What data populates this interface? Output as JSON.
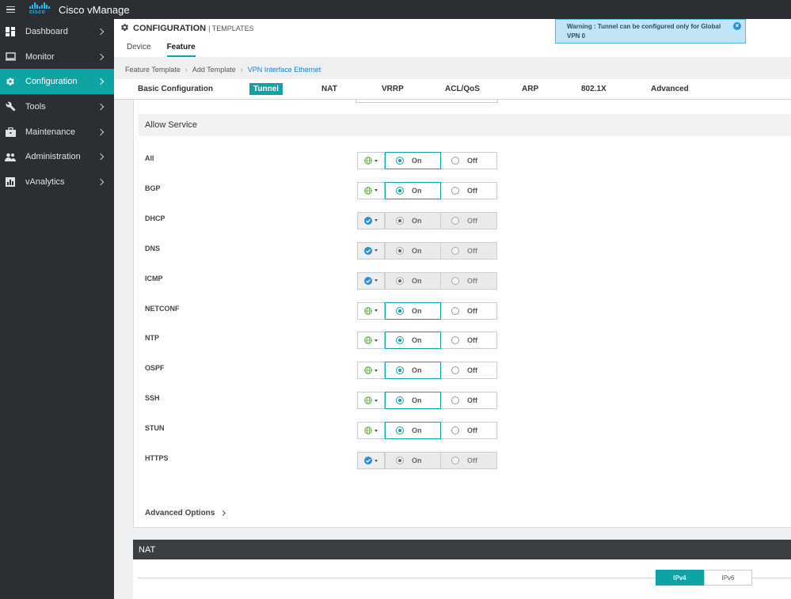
{
  "app": {
    "title": "Cisco vManage",
    "logo_text": "cisco"
  },
  "sidebar": {
    "items": [
      {
        "label": "Dashboard",
        "icon": "dashboard-icon"
      },
      {
        "label": "Monitor",
        "icon": "monitor-icon"
      },
      {
        "label": "Configuration",
        "icon": "gear-icon",
        "active": true
      },
      {
        "label": "Tools",
        "icon": "wrench-icon"
      },
      {
        "label": "Maintenance",
        "icon": "toolbox-icon"
      },
      {
        "label": "Administration",
        "icon": "users-icon"
      },
      {
        "label": "vAnalytics",
        "icon": "analytics-icon"
      }
    ]
  },
  "header": {
    "title": "CONFIGURATION",
    "subtitle": "| TEMPLATES",
    "tabs": [
      "Device",
      "Feature"
    ],
    "active_tab": "Feature"
  },
  "warning": {
    "text": "Warning : Tunnel can be configured only for Global VPN 0"
  },
  "breadcrumb": [
    "Feature Template",
    "Add Template",
    "VPN Interface Ethernet"
  ],
  "section_tabs": [
    "Basic Configuration",
    "Tunnel",
    "NAT",
    "VRRP",
    "ACL/QoS",
    "ARP",
    "802.1X",
    "Advanced"
  ],
  "active_section": "Tunnel",
  "allow_service": {
    "title": "Allow Service",
    "on_label": "On",
    "off_label": "Off",
    "services": [
      {
        "name": "All",
        "scope": "global",
        "value": "On"
      },
      {
        "name": "BGP",
        "scope": "global",
        "value": "On"
      },
      {
        "name": "DHCP",
        "scope": "default",
        "value": "On"
      },
      {
        "name": "DNS",
        "scope": "default",
        "value": "On"
      },
      {
        "name": "ICMP",
        "scope": "default",
        "value": "On"
      },
      {
        "name": "NETCONF",
        "scope": "global",
        "value": "On"
      },
      {
        "name": "NTP",
        "scope": "global",
        "value": "On"
      },
      {
        "name": "OSPF",
        "scope": "global",
        "value": "On"
      },
      {
        "name": "SSH",
        "scope": "global",
        "value": "On"
      },
      {
        "name": "STUN",
        "scope": "global",
        "value": "On"
      },
      {
        "name": "HTTPS",
        "scope": "default",
        "value": "On"
      }
    ],
    "advanced_options": "Advanced Options"
  },
  "nat": {
    "title": "NAT",
    "ip_tabs": [
      "IPv4",
      "IPv6"
    ],
    "active_ip": "IPv4"
  },
  "colors": {
    "accent": "#10a3a3",
    "sidebar_bg": "#2b2e33",
    "warning_bg": "#bfe5f7",
    "global_icon": "#6ab04c",
    "default_icon": "#2b8fd6"
  }
}
